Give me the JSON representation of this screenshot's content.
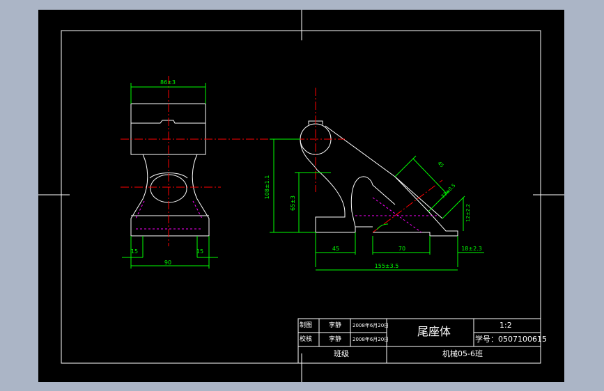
{
  "drawing": {
    "dimensions": {
      "top_width": "86±3",
      "left_offset": "15",
      "right_offset": "15",
      "base_width": "90",
      "height_total": "108±1.1",
      "height_mid": "65±3",
      "slot_width": "45",
      "side_length": "70",
      "right_small": "18±2.3",
      "overall_length": "155±3.5",
      "angle_top": "45",
      "angle_mid": "33±0.5",
      "angle_right": "12±2.2"
    }
  },
  "title_block": {
    "row1_label": "制图",
    "row1_name": "李静",
    "row1_date": "2008年6月20日",
    "row2_label": "校核",
    "row2_name": "李静",
    "row2_date": "2008年6月20日",
    "part_name": "尾座体",
    "scale": "1:2",
    "student_id": "学号：0507100615",
    "class_label": "班级",
    "class_value": "机械05-6班"
  },
  "colors": {
    "background": "#000000",
    "frame": "#ffffff",
    "dimension": "#00ff00",
    "centerline": "#ff0000",
    "hidden": "#ff00ff",
    "outer": "#abb5c6"
  }
}
